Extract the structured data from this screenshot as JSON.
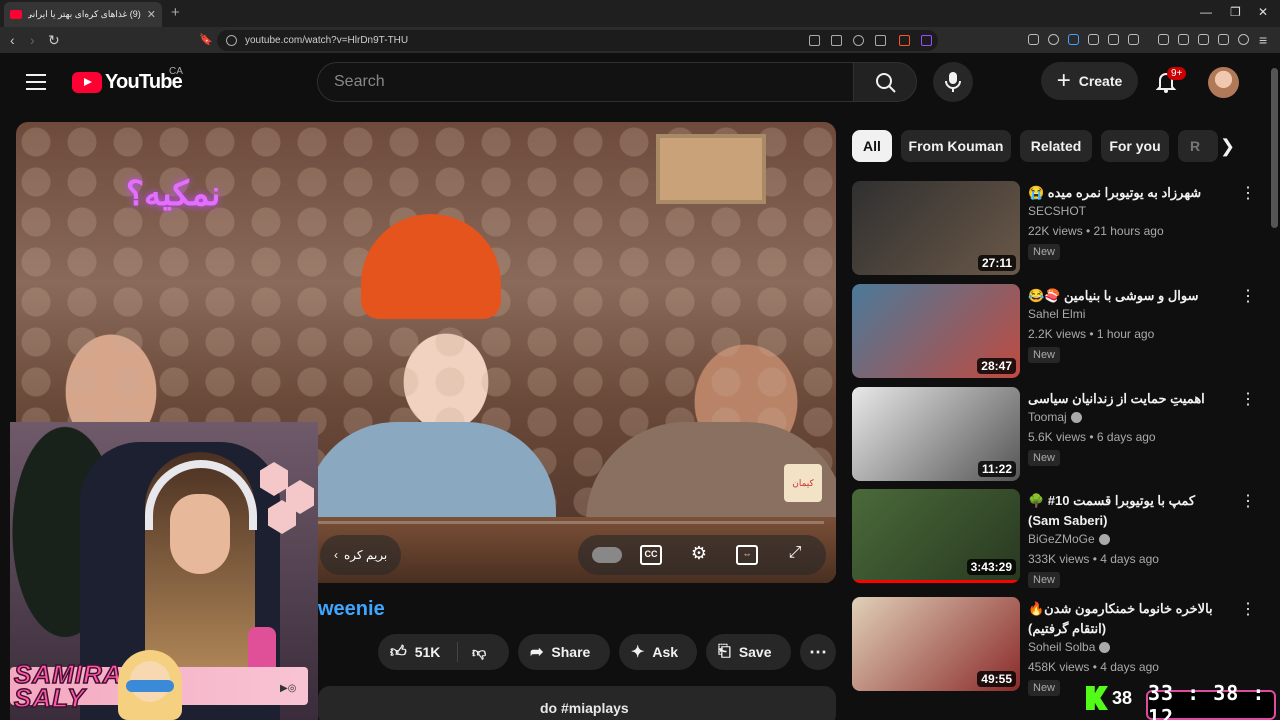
{
  "browser": {
    "tab_title": "(9) غذاهای کره‌ای بهتر یا ایرانی؟!",
    "url": "youtube.com/watch?v=HlrDn9T-THU"
  },
  "header": {
    "logo_text": "YouTube",
    "country": "CA",
    "search_placeholder": "Search",
    "create_label": "Create",
    "notifications": "9+"
  },
  "player": {
    "neon_text": "نمکیه؟",
    "skip_label": "بریم کره",
    "brand_tag": "کیمان"
  },
  "video": {
    "title_fragment": "weenie",
    "likes": "51K",
    "share_label": "Share",
    "ask_label": "Ask",
    "save_label": "Save",
    "description_fragment": "do #miaplays"
  },
  "chips": [
    "All",
    "From Kouman",
    "Related",
    "For you",
    "R"
  ],
  "recommendations": [
    {
      "title": "شهرزاد به یوتیوبرا نمره میده 😭",
      "channel": "SECSHOT",
      "verified": false,
      "meta": "22K views • 21 hours ago",
      "badge": "New",
      "duration": "27:11",
      "thumb_colors": [
        "#3a3a3a",
        "#5a4a40"
      ]
    },
    {
      "title": "سوال و سوشی با بنیامین 🍣😂",
      "channel": "Sahel Elmi",
      "verified": false,
      "meta": "2.2K views • 1 hour ago",
      "badge": "New",
      "duration": "28:47",
      "thumb_colors": [
        "#3a6a8a",
        "#c04040"
      ]
    },
    {
      "title": "اهمیتِ حمایت از زندانیان سیاسی",
      "channel": "Toomaj",
      "verified": true,
      "meta": "5.6K views • 6 days ago",
      "badge": "New",
      "duration": "11:22",
      "thumb_colors": [
        "#e8e8e8",
        "#444444"
      ]
    },
    {
      "title": "کمپ با یوتیوبرا قسمت 10# 🌳 (Sam Saberi)",
      "channel": "BiGeZMoGe",
      "verified": true,
      "meta": "333K views • 4 days ago",
      "badge": "New",
      "duration": "3:43:29",
      "progress": 0.98,
      "thumb_colors": [
        "#3a5a2a",
        "#2a3a20"
      ]
    },
    {
      "title": "بالاخره خانوما خمنکارمون شدن🔥(انتقام گرفتیم)",
      "channel": "Soheil Solba",
      "verified": true,
      "meta": "458K views • 4 days ago",
      "badge": "New",
      "duration": "49:55",
      "thumb_colors": [
        "#d8c8b0",
        "#8a2020"
      ]
    }
  ],
  "stream": {
    "name_line1": "SAMIRA",
    "name_line2": "SALY",
    "kick_viewers": "38",
    "timer": "33 : 38 : 12"
  }
}
